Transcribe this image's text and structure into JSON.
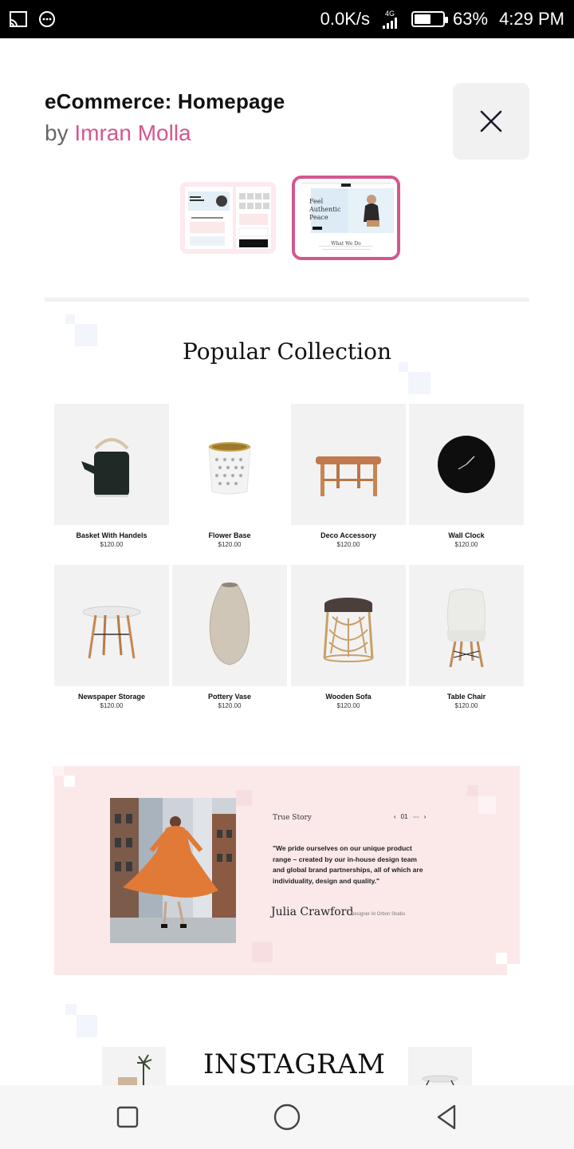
{
  "status_bar": {
    "net_speed": "0.0K/s",
    "network_type": "4G",
    "battery": "63%",
    "battery_level": 0.63,
    "time": "4:29 PM"
  },
  "header": {
    "title": "eCommerce: Homepage",
    "by_prefix": "by",
    "author": "Imran Molla"
  },
  "thumbnails": {
    "thumb2_text1": "Feel",
    "thumb2_text2": "Authentic",
    "thumb2_text3": "Peace",
    "thumb2_caption": "What We Do"
  },
  "collection": {
    "title": "Popular Collection",
    "products": [
      {
        "name": "Basket With Handels",
        "price": "$120.00",
        "icon": "kettle-image"
      },
      {
        "name": "Flower Base",
        "price": "$120.00",
        "icon": "cup-image"
      },
      {
        "name": "Deco Accessory",
        "price": "$120.00",
        "icon": "round-table-image"
      },
      {
        "name": "Wall Clock",
        "price": "$120.00",
        "icon": "wall-clock-image"
      },
      {
        "name": "Newspaper Storage",
        "price": "$120.00",
        "icon": "side-table-image"
      },
      {
        "name": "Pottery Vase",
        "price": "$120.00",
        "icon": "vase-image"
      },
      {
        "name": "Wooden Sofa",
        "price": "$120.00",
        "icon": "stool-image"
      },
      {
        "name": "Table Chair",
        "price": "$120.00",
        "icon": "chair-image"
      }
    ]
  },
  "story": {
    "label": "True Story",
    "prev": "‹",
    "page": "01",
    "next": "›",
    "quote": "\"We pride ourselves on our unique product range – created by our in-house design team and global brand partnerships, all of which are individuality, design and quality.\"",
    "name": "Julia Crawford",
    "role": "Designer At Orbon Studio"
  },
  "instagram": {
    "title": "INSTAGRAM"
  },
  "colors": {
    "accent": "#d4578f",
    "story_bg": "#fbe9ea",
    "tile_bg": "#f2f2f2"
  }
}
